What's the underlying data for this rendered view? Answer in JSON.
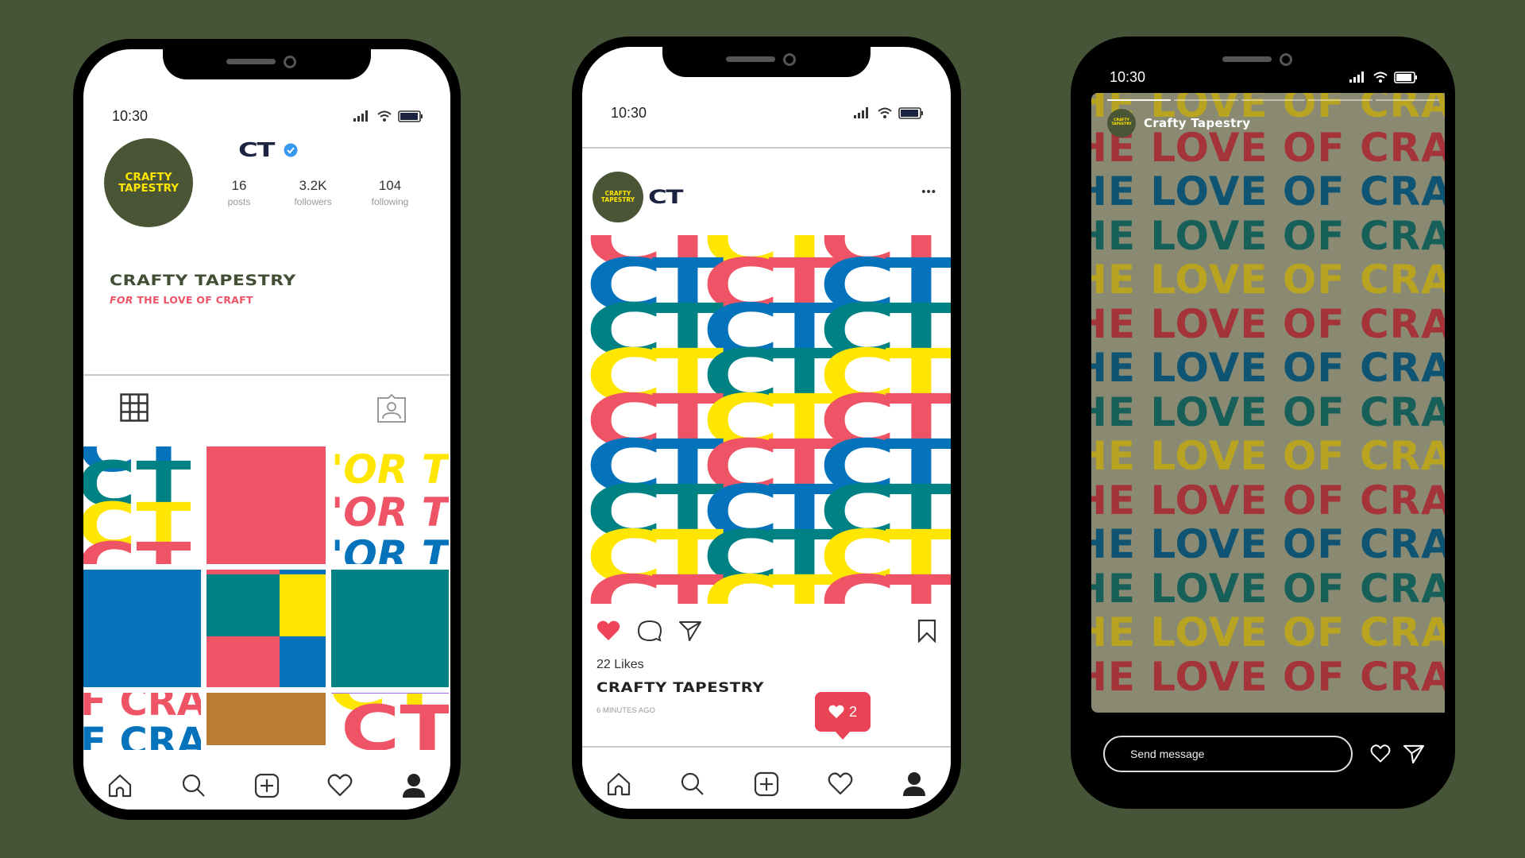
{
  "theme": {
    "background": "#465537",
    "brand_green": "#4a5535",
    "brand_yellow": "#ffe600",
    "pink": "#ef5466",
    "blue": "#0473bb",
    "teal": "#008184",
    "gold": "#b87c33",
    "navy": "#1c2340"
  },
  "status_bar": {
    "time": "10:30"
  },
  "profile_phone": {
    "handle_logo": "CT",
    "verified": true,
    "avatar_lines": [
      "CRAFTY",
      "TAPESTRY"
    ],
    "stats": [
      {
        "value": "16",
        "label": "posts"
      },
      {
        "value": "3.2K",
        "label": "followers"
      },
      {
        "value": "104",
        "label": "following"
      }
    ],
    "display_name": "CRAFTY TAPESTRY",
    "bio_italic": "FOR",
    "bio_rest": " THE LOVE OF CRAFT",
    "tabs": [
      {
        "icon": "grid-icon",
        "active": true
      },
      {
        "icon": "tagged-icon",
        "active": false
      }
    ],
    "grid_tiles": [
      {
        "type": "ct-pattern"
      },
      {
        "type": "solid",
        "color": "#ef5466"
      },
      {
        "type": "text-pattern",
        "text": "'OR TI"
      },
      {
        "type": "solid",
        "color": "#0473bb"
      },
      {
        "type": "quad",
        "colors": [
          "#008184",
          "#ffe600",
          "#ef5466",
          "#0473bb"
        ]
      },
      {
        "type": "solid",
        "color": "#008184"
      },
      {
        "type": "text-pattern",
        "text": "F CRA"
      },
      {
        "type": "solid",
        "color": "#b87c33"
      },
      {
        "type": "ct-pattern"
      }
    ]
  },
  "post_phone": {
    "author_avatar_lines": [
      "CRAFTY",
      "TAPESTRY"
    ],
    "author_logo": "CT",
    "more_label": "•••",
    "pattern_text": "CT",
    "likes": "22 Likes",
    "caption_author": "CRAFTY TAPESTRY",
    "timestamp": "6 MINUTES AGO",
    "notification_count": "2",
    "liked": true
  },
  "story_phone": {
    "author_avatar_lines": [
      "CRAFTY",
      "TAPESTRY"
    ],
    "author_name": "Crafty Tapestry",
    "segments_total": 5,
    "segments_viewed": 1,
    "story_line_text": "HE LOVE OF CRAFT",
    "message_placeholder": "Send message"
  },
  "nav": {
    "items": [
      {
        "name": "home",
        "icon": "home-icon"
      },
      {
        "name": "search",
        "icon": "search-icon"
      },
      {
        "name": "create",
        "icon": "add-post-icon"
      },
      {
        "name": "activity",
        "icon": "heart-icon"
      },
      {
        "name": "profile",
        "icon": "profile-icon"
      }
    ]
  }
}
